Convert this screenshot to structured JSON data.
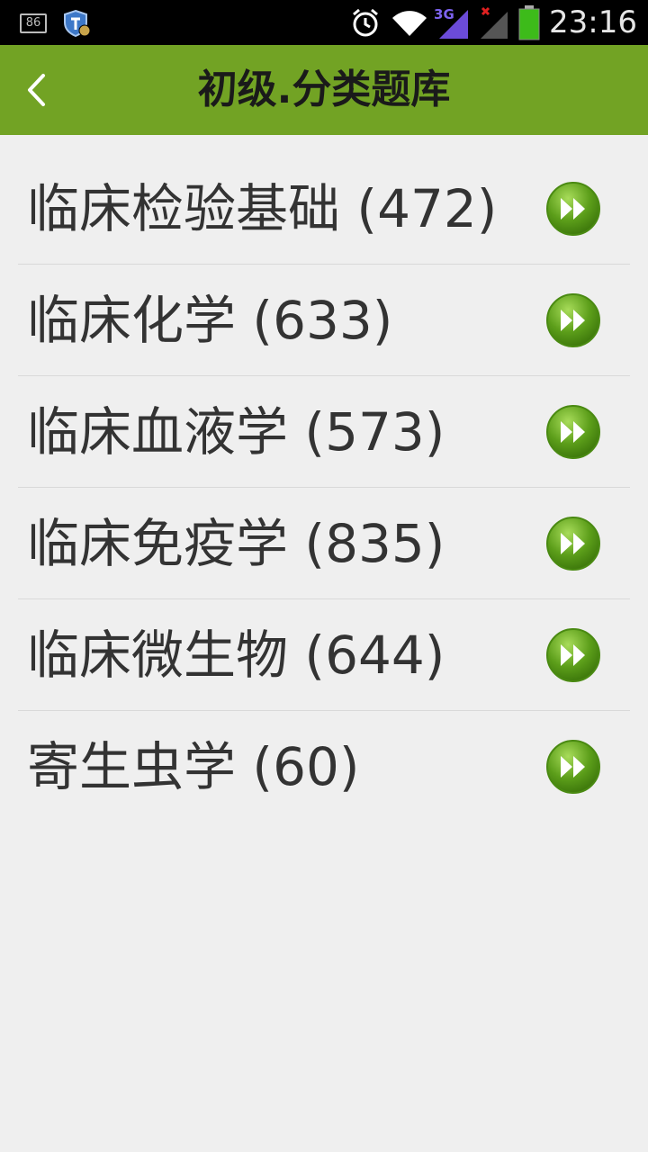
{
  "status_bar": {
    "badge_number": "86",
    "network_label": "3G",
    "time": "23:16"
  },
  "app_bar": {
    "title": "初级.分类题库",
    "back_icon": "chevron-left-icon"
  },
  "list": {
    "items": [
      {
        "label": "临床检验基础 (472)"
      },
      {
        "label": "临床化学 (633)"
      },
      {
        "label": "临床血液学 (573)"
      },
      {
        "label": "临床免疫学 (835)"
      },
      {
        "label": "临床微生物 (644)"
      },
      {
        "label": "寄生虫学 (60)"
      }
    ],
    "action_icon": "fast-forward-icon"
  },
  "colors": {
    "status_bar_bg": "#000000",
    "app_bar_bg": "#72a324",
    "page_bg": "#efefef",
    "accent_green": "#5c9e1a",
    "battery_green": "#3dbb1a",
    "signal_purple": "#6b4bd8"
  }
}
